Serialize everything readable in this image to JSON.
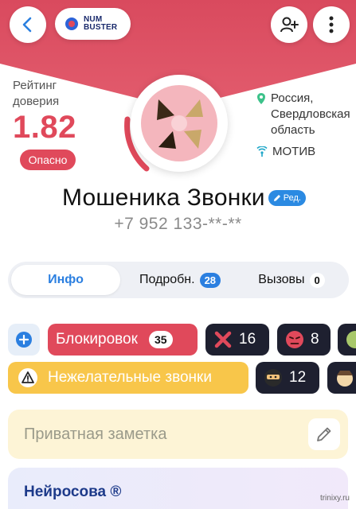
{
  "header": {
    "logo_line1": "NUM",
    "logo_line2": "BUSTER"
  },
  "rating": {
    "label": "Рейтинг доверия",
    "value": "1.82",
    "status": "Опасно"
  },
  "location": {
    "region": "Россия, Свердловская область",
    "carrier": "МОТИВ"
  },
  "profile": {
    "name": "Мошеника Звонки",
    "edit_label": "Ред.",
    "phone": "+7 952 133-**-**"
  },
  "tabs": [
    {
      "label": "Инфо"
    },
    {
      "label": "Подробн.",
      "count": "28"
    },
    {
      "label": "Вызовы",
      "count": "0"
    }
  ],
  "chips": {
    "block_label": "Блокировок",
    "block_count": "35",
    "x_count": "16",
    "angry_count": "8",
    "unwanted_label": "Нежелательные звонки",
    "ninja_count": "12"
  },
  "note": {
    "placeholder": "Приватная заметка"
  },
  "neuro": {
    "title": "Нейросова ®"
  },
  "watermark": "trinixy.ru",
  "colors": {
    "danger": "#e0495b",
    "accent": "#2b7fe0",
    "warning": "#f8c64a",
    "dark_chip": "#1e2030"
  }
}
